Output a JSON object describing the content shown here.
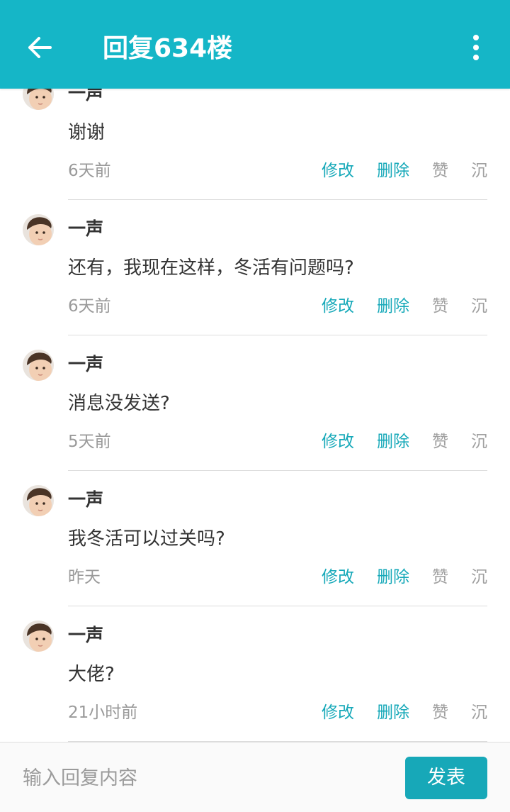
{
  "header": {
    "title": "回复634楼",
    "back_icon": "arrow-left-icon",
    "menu_icon": "more-vertical-icon"
  },
  "reply_actions": {
    "edit": "修改",
    "delete": "删除",
    "like": "赞",
    "sink": "沉"
  },
  "replies": [
    {
      "author": "一声",
      "content": "谢谢",
      "time": "6天前"
    },
    {
      "author": "一声",
      "content": "还有，我现在这样，冬活有问题吗?",
      "time": "6天前"
    },
    {
      "author": "一声",
      "content": "消息没发送?",
      "time": "5天前"
    },
    {
      "author": "一声",
      "content": "我冬活可以过关吗?",
      "time": "昨天"
    },
    {
      "author": "一声",
      "content": "大佬?",
      "time": "21小时前"
    }
  ],
  "composer": {
    "placeholder": "输入回复内容",
    "submit_label": "发表"
  },
  "colors": {
    "header_bg": "#15b6c7",
    "accent": "#17a9b9",
    "muted": "#a0a0a0",
    "text": "#333333",
    "divider": "#dcdcdc"
  }
}
